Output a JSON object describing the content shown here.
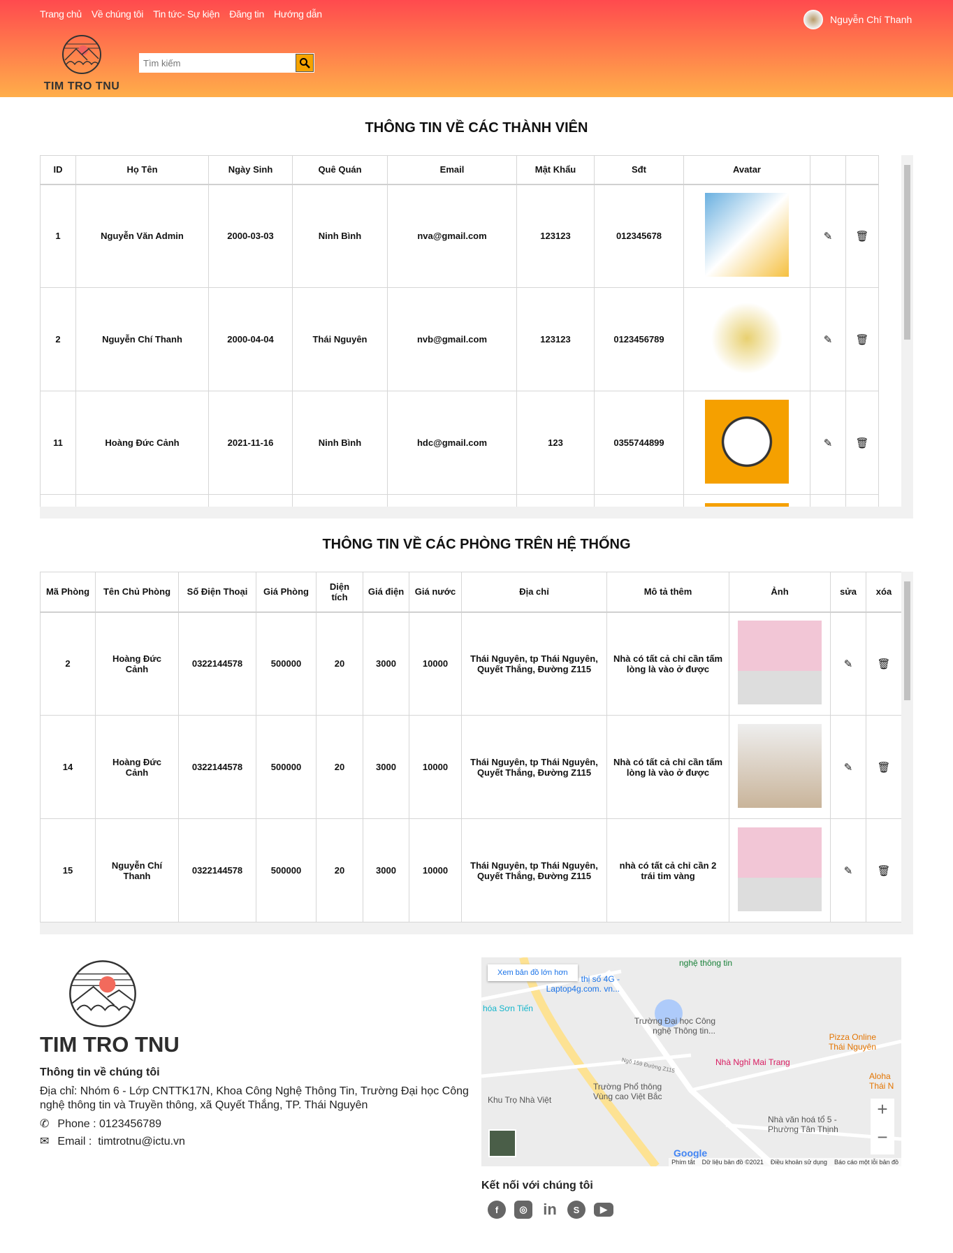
{
  "header": {
    "nav": [
      "Trang chủ",
      "Về chúng tôi",
      "Tin tức- Sự kiện",
      "Đăng tin",
      "Hướng dẫn"
    ],
    "logo_text": "TIM TRO TNU",
    "search_placeholder": "Tìm kiếm",
    "user_name": "Nguyễn Chí Thanh"
  },
  "members": {
    "title": "THÔNG TIN VỀ CÁC THÀNH VIÊN",
    "columns": [
      "ID",
      "Họ Tên",
      "Ngày Sinh",
      "Quê Quán",
      "Email",
      "Mật Khẩu",
      "Sđt",
      "Avatar",
      "",
      ""
    ],
    "rows": [
      {
        "id": "1",
        "name": "Nguyễn Văn Admin",
        "dob": "2000-03-03",
        "home": "Ninh Bình",
        "email": "nva@gmail.com",
        "password": "123123",
        "phone": "012345678"
      },
      {
        "id": "2",
        "name": "Nguyễn Chí Thanh",
        "dob": "2000-04-04",
        "home": "Thái Nguyên",
        "email": "nvb@gmail.com",
        "password": "123123",
        "phone": "0123456789"
      },
      {
        "id": "11",
        "name": "Hoàng Đức Cảnh",
        "dob": "2021-11-16",
        "home": "Ninh Bình",
        "email": "hdc@gmail.com",
        "password": "123",
        "phone": "0355744899"
      }
    ]
  },
  "rooms": {
    "title": "THÔNG TIN VỀ CÁC PHÒNG TRÊN HỆ THỐNG",
    "columns": [
      "Mã Phòng",
      "Tên Chủ Phòng",
      "Số Điện Thoại",
      "Giá Phòng",
      "Diện tích",
      "Giá điện",
      "Giá nước",
      "Địa chỉ",
      "Mô tả thêm",
      "Ảnh",
      "sửa",
      "xóa"
    ],
    "rows": [
      {
        "id": "2",
        "owner": "Hoàng Đức Cảnh",
        "phone": "0322144578",
        "price": "500000",
        "area": "20",
        "elec": "3000",
        "water": "10000",
        "address": "Thái Nguyên, tp Thái Nguyên, Quyết Thắng, Đường Z115",
        "desc": "Nhà có tất cả chỉ cần tấm lòng là vào ở được"
      },
      {
        "id": "14",
        "owner": "Hoàng Đức Cảnh",
        "phone": "0322144578",
        "price": "500000",
        "area": "20",
        "elec": "3000",
        "water": "10000",
        "address": "Thái Nguyên, tp Thái Nguyên, Quyết Thắng, Đường Z115",
        "desc": "Nhà có tất cả chỉ cần tấm lòng là vào ở được"
      },
      {
        "id": "15",
        "owner": "Nguyễn Chí Thanh",
        "phone": "0322144578",
        "price": "500000",
        "area": "20",
        "elec": "3000",
        "water": "10000",
        "address": "Thái Nguyên, tp Thái Nguyên, Quyết Thắng, Đường Z115",
        "desc": "nhà có tất cả chỉ cần 2 trái tim vàng"
      }
    ]
  },
  "footer": {
    "logo_text": "TIM TRO TNU",
    "about_title": "Thông tin về chúng tôi",
    "address": "Địa chỉ: Nhóm 6 - Lớp CNTTK17N, Khoa Công Nghệ Thông Tin, Trường Đại học Công nghệ thông tin và Truyền thông, xã Quyết Thắng, TP. Thái Nguyên",
    "phone": "Phone : 0123456789",
    "email_label": "Email :",
    "email": "timtrotnu@ictu.vn",
    "connect_title": "Kết nối với chúng tôi",
    "social": [
      "facebook",
      "instagram",
      "linkedin",
      "skype",
      "youtube"
    ]
  },
  "map": {
    "larger_link": "Xem bản đồ lớn hơn",
    "labels": [
      "nghệ thông tin",
      "thị số 4G - Laptop4g.com. vn...",
      "hóa Sơn Tiến",
      "Trường Đại học Công nghệ Thông tin...",
      "Pizza Online Thái Nguyên",
      "Nhà Nghỉ Mai Trang",
      "Aloha Thái N",
      "Trường Phổ thông Vùng cao Việt Bắc",
      "Khu Trọ Nhà Việt",
      "Nhà văn hoá tổ 5 - Phường Tân Thịnh",
      "Ngõ 159 Đường Z115"
    ],
    "footer": [
      "Phím tắt",
      "Dữ liệu bản đồ ©2021",
      "Điều khoản sử dụng",
      "Báo cáo một lỗi bản đồ"
    ],
    "brand": "Google"
  }
}
